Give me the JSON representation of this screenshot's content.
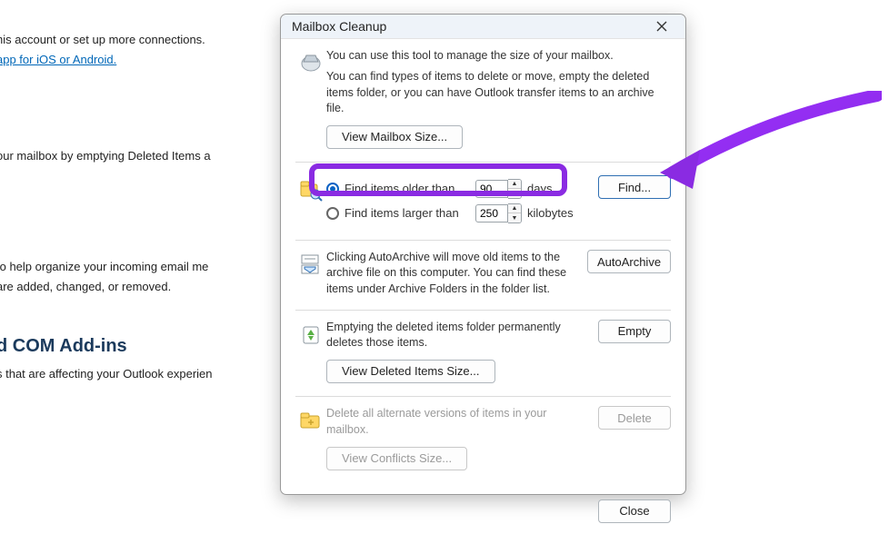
{
  "background": {
    "line1": "his account or set up more connections.",
    "link": "app for iOS or Android.",
    "line2": "our mailbox by emptying Deleted Items a",
    "line3": "to help organize your incoming email me",
    "line4": "are added, changed, or removed.",
    "heading": "d COM Add-ins",
    "line5": "s that are affecting your Outlook experien"
  },
  "dialog": {
    "title": "Mailbox Cleanup",
    "intro": {
      "line1": "You can use this tool to manage the size of your mailbox.",
      "line2": "You can find types of items to delete or move, empty the deleted items folder, or you can have Outlook transfer items to an archive file.",
      "view_mailbox_size": "View Mailbox Size..."
    },
    "find": {
      "older_label": "Find items older than",
      "older_value": "90",
      "older_unit": "days",
      "larger_label": "Find items larger than",
      "larger_value": "250",
      "larger_unit": "kilobytes",
      "find_button": "Find..."
    },
    "autoarchive": {
      "text": "Clicking AutoArchive will move old items to the archive file on this computer. You can find these items under Archive Folders in the folder list.",
      "button": "AutoArchive"
    },
    "empty": {
      "text": "Emptying the deleted items folder permanently deletes those items.",
      "button": "Empty",
      "view_deleted_size": "View Deleted Items Size..."
    },
    "conflicts": {
      "text": "Delete all alternate versions of items in your mailbox.",
      "button": "Delete",
      "view_conflicts_size": "View Conflicts Size..."
    },
    "close": "Close"
  }
}
